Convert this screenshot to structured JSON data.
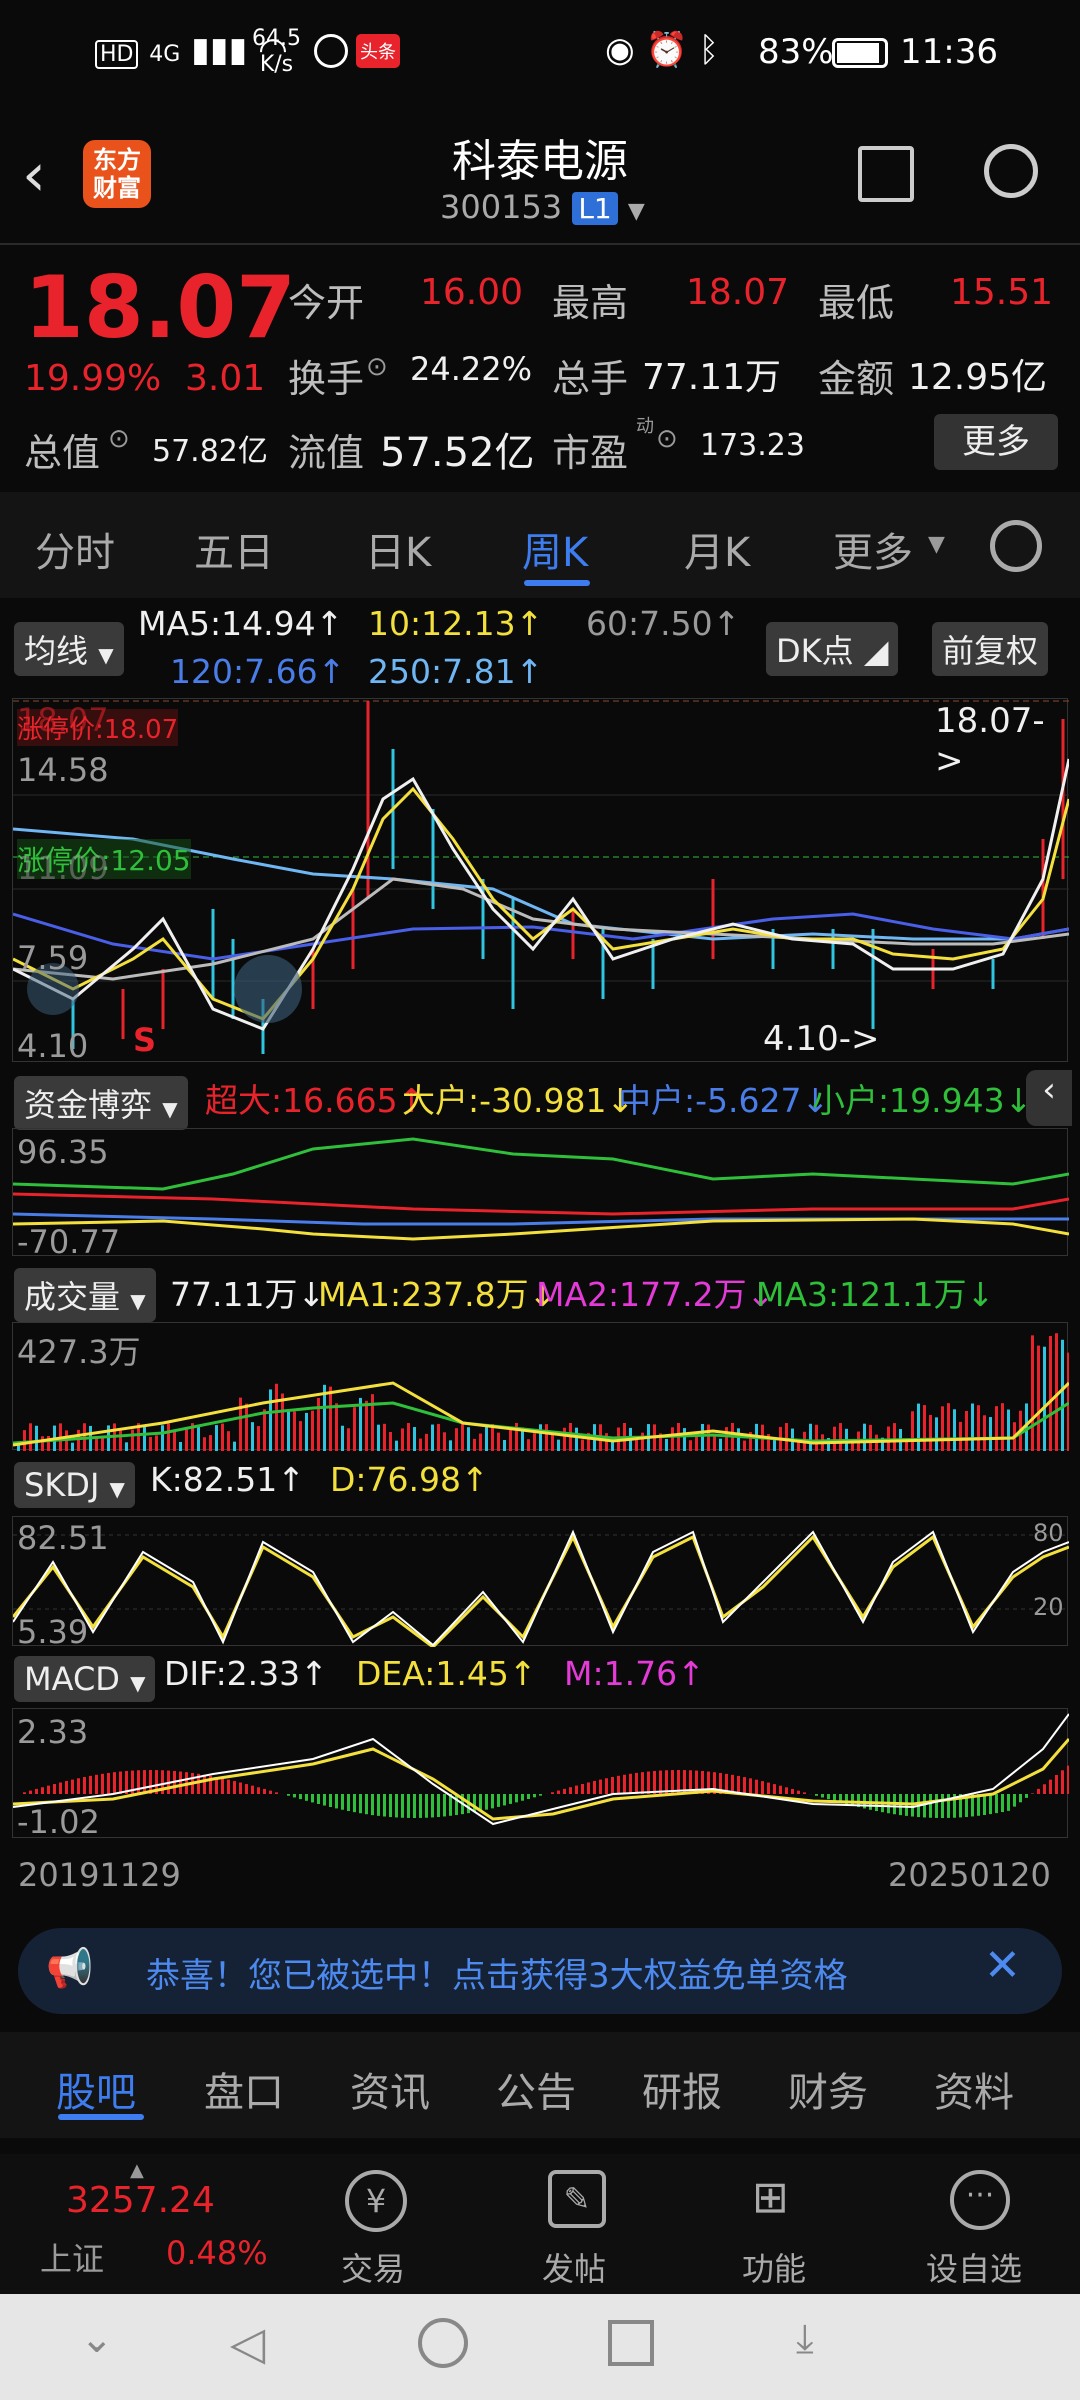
{
  "status_bar": {
    "network_speed": "64.5\nK/s",
    "net1": "HD",
    "net2": "4G",
    "badge": "头条",
    "battery": "83%",
    "time": "11:36"
  },
  "header": {
    "app_logo_line1": "东方",
    "app_logo_line2": "财富",
    "title": "科泰电源",
    "code": "300153",
    "level_badge": "L1"
  },
  "quote": {
    "price": "18.07",
    "change_pct": "19.99%",
    "change_abs": "3.01",
    "open_label": "今开",
    "open": "16.00",
    "high_label": "最高",
    "high": "18.07",
    "low_label": "最低",
    "low": "15.51",
    "turnover_label": "换手",
    "turnover": "24.22%",
    "volume_label": "总手",
    "volume": "77.11万",
    "amount_label": "金额",
    "amount": "12.95亿",
    "mktcap_label": "总值",
    "mktcap": "57.82亿",
    "float_label": "流值",
    "float": "57.52亿",
    "pe_label": "市盈",
    "pe_sup": "动",
    "pe": "173.23",
    "more": "更多"
  },
  "period_tabs": [
    "分时",
    "五日",
    "日K",
    "周K",
    "月K",
    "更多"
  ],
  "active_tab": "周K",
  "ma": {
    "chip": "均线",
    "ma5": "MA5:14.94↑",
    "ma10": "10:12.13↑",
    "ma60": "60:7.50↑",
    "ma120": "120:7.66↑",
    "ma250": "250:7.81↑",
    "dk": "DK点",
    "fq": "前复权"
  },
  "kline": {
    "axis_top": "18.07",
    "limit_up": "涨停价:18.07",
    "limit_up_short": "涨停价:12.05",
    "y2": "14.58",
    "y3": "11.09",
    "y4": "7.59",
    "y5": "4.10",
    "last_marker": "18.07->",
    "low_marker": "4.10->",
    "s_marker": "S"
  },
  "fund": {
    "chip": "资金博弈",
    "super": "超大:16.665↑",
    "big": "大户:-30.981↓",
    "mid": "中户:-5.627↓",
    "small": "小户:19.943↓",
    "top": "96.35",
    "bottom": "-70.77"
  },
  "vol": {
    "chip": "成交量",
    "v": "77.11万↓",
    "ma1": "MA1:237.8万↓",
    "ma2": "MA2:177.2万↓",
    "ma3": "MA3:121.1万↓",
    "top": "427.3万"
  },
  "skdj": {
    "chip": "SKDJ",
    "k": "K:82.51↑",
    "d": "D:76.98↑",
    "top": "82.51",
    "bottom": "5.39",
    "r80": "80",
    "r20": "20"
  },
  "macd": {
    "chip": "MACD",
    "dif": "DIF:2.33↑",
    "dea": "DEA:1.45↑",
    "m": "M:1.76↑",
    "top": "2.33",
    "bottom": "-1.02"
  },
  "dates": {
    "start": "20191129",
    "end": "20250120"
  },
  "banner": {
    "text": "恭喜！您已被选中！点击获得3大权益免单资格"
  },
  "bottom_tabs": [
    "股吧",
    "盘口",
    "资讯",
    "公告",
    "研报",
    "财务",
    "资料"
  ],
  "dock": {
    "index_value": "3257.24",
    "index_name": "上证",
    "index_pct": "0.48%",
    "trade": "交易",
    "post": "发帖",
    "func": "功能",
    "watch": "设自选"
  }
}
